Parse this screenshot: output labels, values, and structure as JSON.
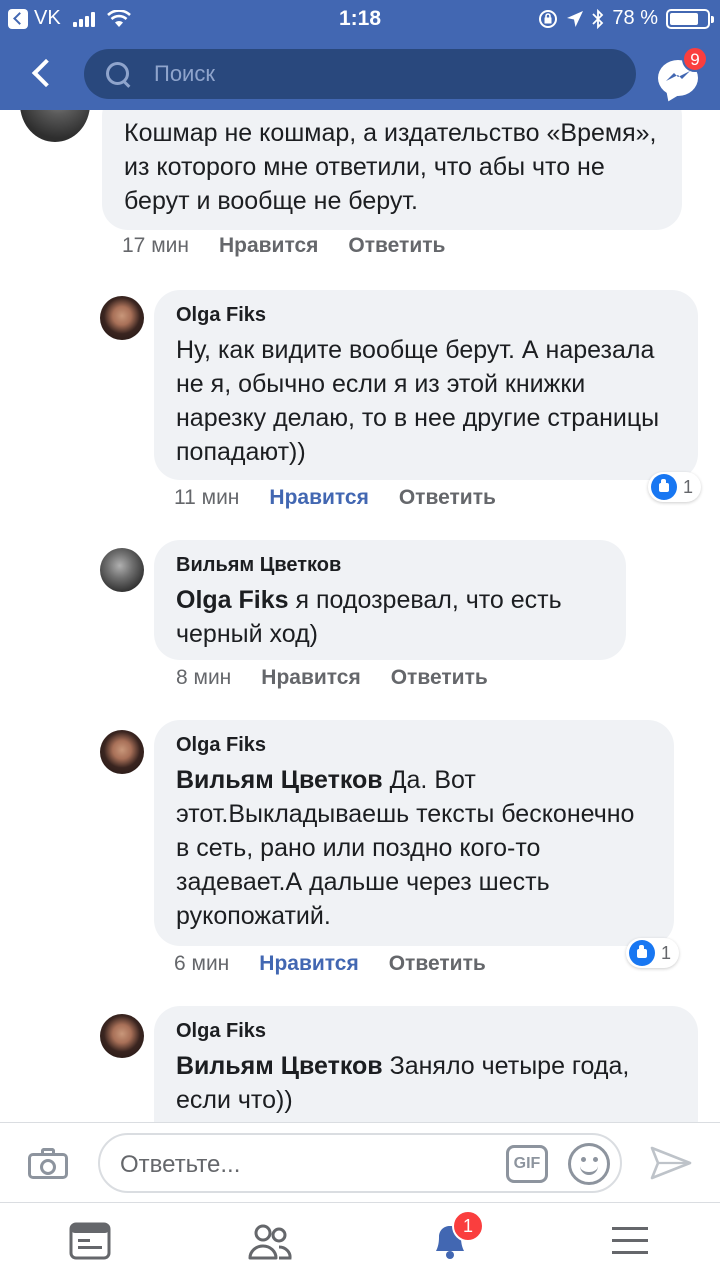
{
  "status_bar": {
    "carrier": "VK",
    "time": "1:18",
    "battery": "78 %",
    "battery_level": 0.78
  },
  "header": {
    "search_placeholder": "Поиск",
    "messenger_badge": "9"
  },
  "comments": [
    {
      "author": "",
      "mention": "",
      "text": "Кошмар не кошмар, а издательство «Время», из которого мне ответили, что абы что не берут и вообще не берут.",
      "time": "17 мин",
      "like_label": "Нравится",
      "reply_label": "Ответить",
      "liked": false,
      "reactions": ""
    },
    {
      "author": "Olga Fiks",
      "mention": "",
      "text": "Ну, как видите вообще берут. А нарезала не я,  обычно если я из этой книжки нарезку делаю, то в нее другие страницы попадают))",
      "time": "11 мин",
      "like_label": "Нравится",
      "reply_label": "Ответить",
      "liked": true,
      "reactions": "1"
    },
    {
      "author": "Вильям Цветков",
      "mention": "Olga Fiks",
      "text": "я подозревал, что есть черный ход)",
      "time": "8 мин",
      "like_label": "Нравится",
      "reply_label": "Ответить",
      "liked": false,
      "reactions": ""
    },
    {
      "author": "Olga Fiks",
      "mention": "Вильям Цветков",
      "text": "Да. Вот этот.Выкладываешь тексты бесконечно в сеть, рано или поздно кого-то задевает.А дальше через шесть рукопожатий.",
      "time": "6 мин",
      "like_label": "Нравится",
      "reply_label": "Ответить",
      "liked": true,
      "reactions": "1"
    },
    {
      "author": "Olga Fiks",
      "mention": "Вильям Цветков",
      "text": "Заняло четыре года, если что))",
      "time": "",
      "like_label": "",
      "reply_label": "",
      "liked": false,
      "reactions": ""
    }
  ],
  "reply_bar": {
    "placeholder": "Ответьте...",
    "gif_label": "GIF"
  },
  "tab_bar": {
    "notifications_badge": "1"
  },
  "colors": {
    "brand": "#4267b2",
    "liked": "#4267b2",
    "badge": "#fa3e3e",
    "bubble": "#f0f2f5"
  }
}
